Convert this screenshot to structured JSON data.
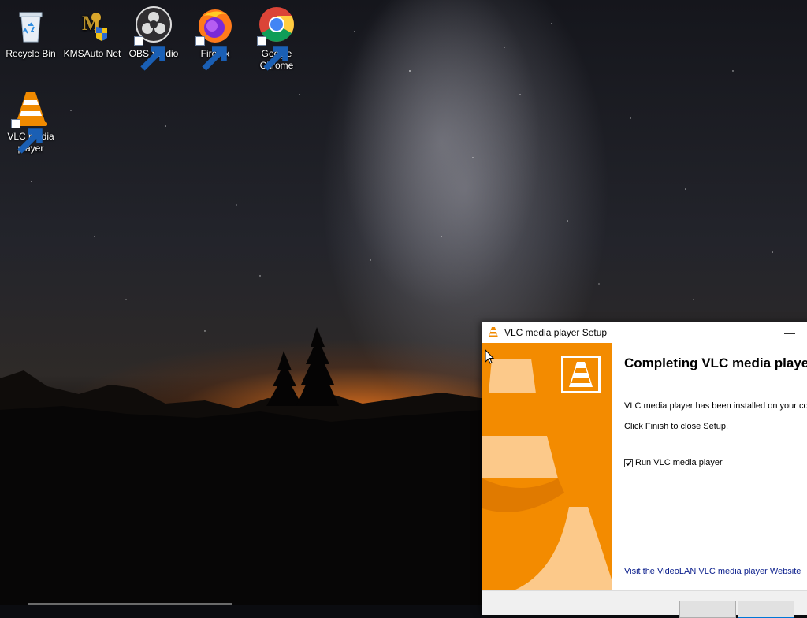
{
  "desktop": {
    "icons": [
      {
        "label": "Recycle Bin",
        "icon": "recycle-bin-icon"
      },
      {
        "label": "KMSAuto Net",
        "icon": "kmsauto-icon"
      },
      {
        "label": "OBS Studio",
        "icon": "obs-icon"
      },
      {
        "label": "Firefox",
        "icon": "firefox-icon"
      },
      {
        "label": "Google Chrome",
        "icon": "chrome-icon"
      },
      {
        "label": "VLC media player",
        "icon": "vlc-icon"
      }
    ]
  },
  "installer": {
    "title": "VLC media player Setup",
    "heading": "Completing VLC media player",
    "description_line1": "VLC media player has been installed on your computer.",
    "description_line2": "Click Finish to close Setup.",
    "run_checkbox_label": "Run VLC media player",
    "run_checked": true,
    "website_link": "Visit the VideoLAN VLC media player Website",
    "minimize_symbol": "—",
    "colors": {
      "banner": "#f38b00",
      "link": "#0a1e8c"
    }
  }
}
